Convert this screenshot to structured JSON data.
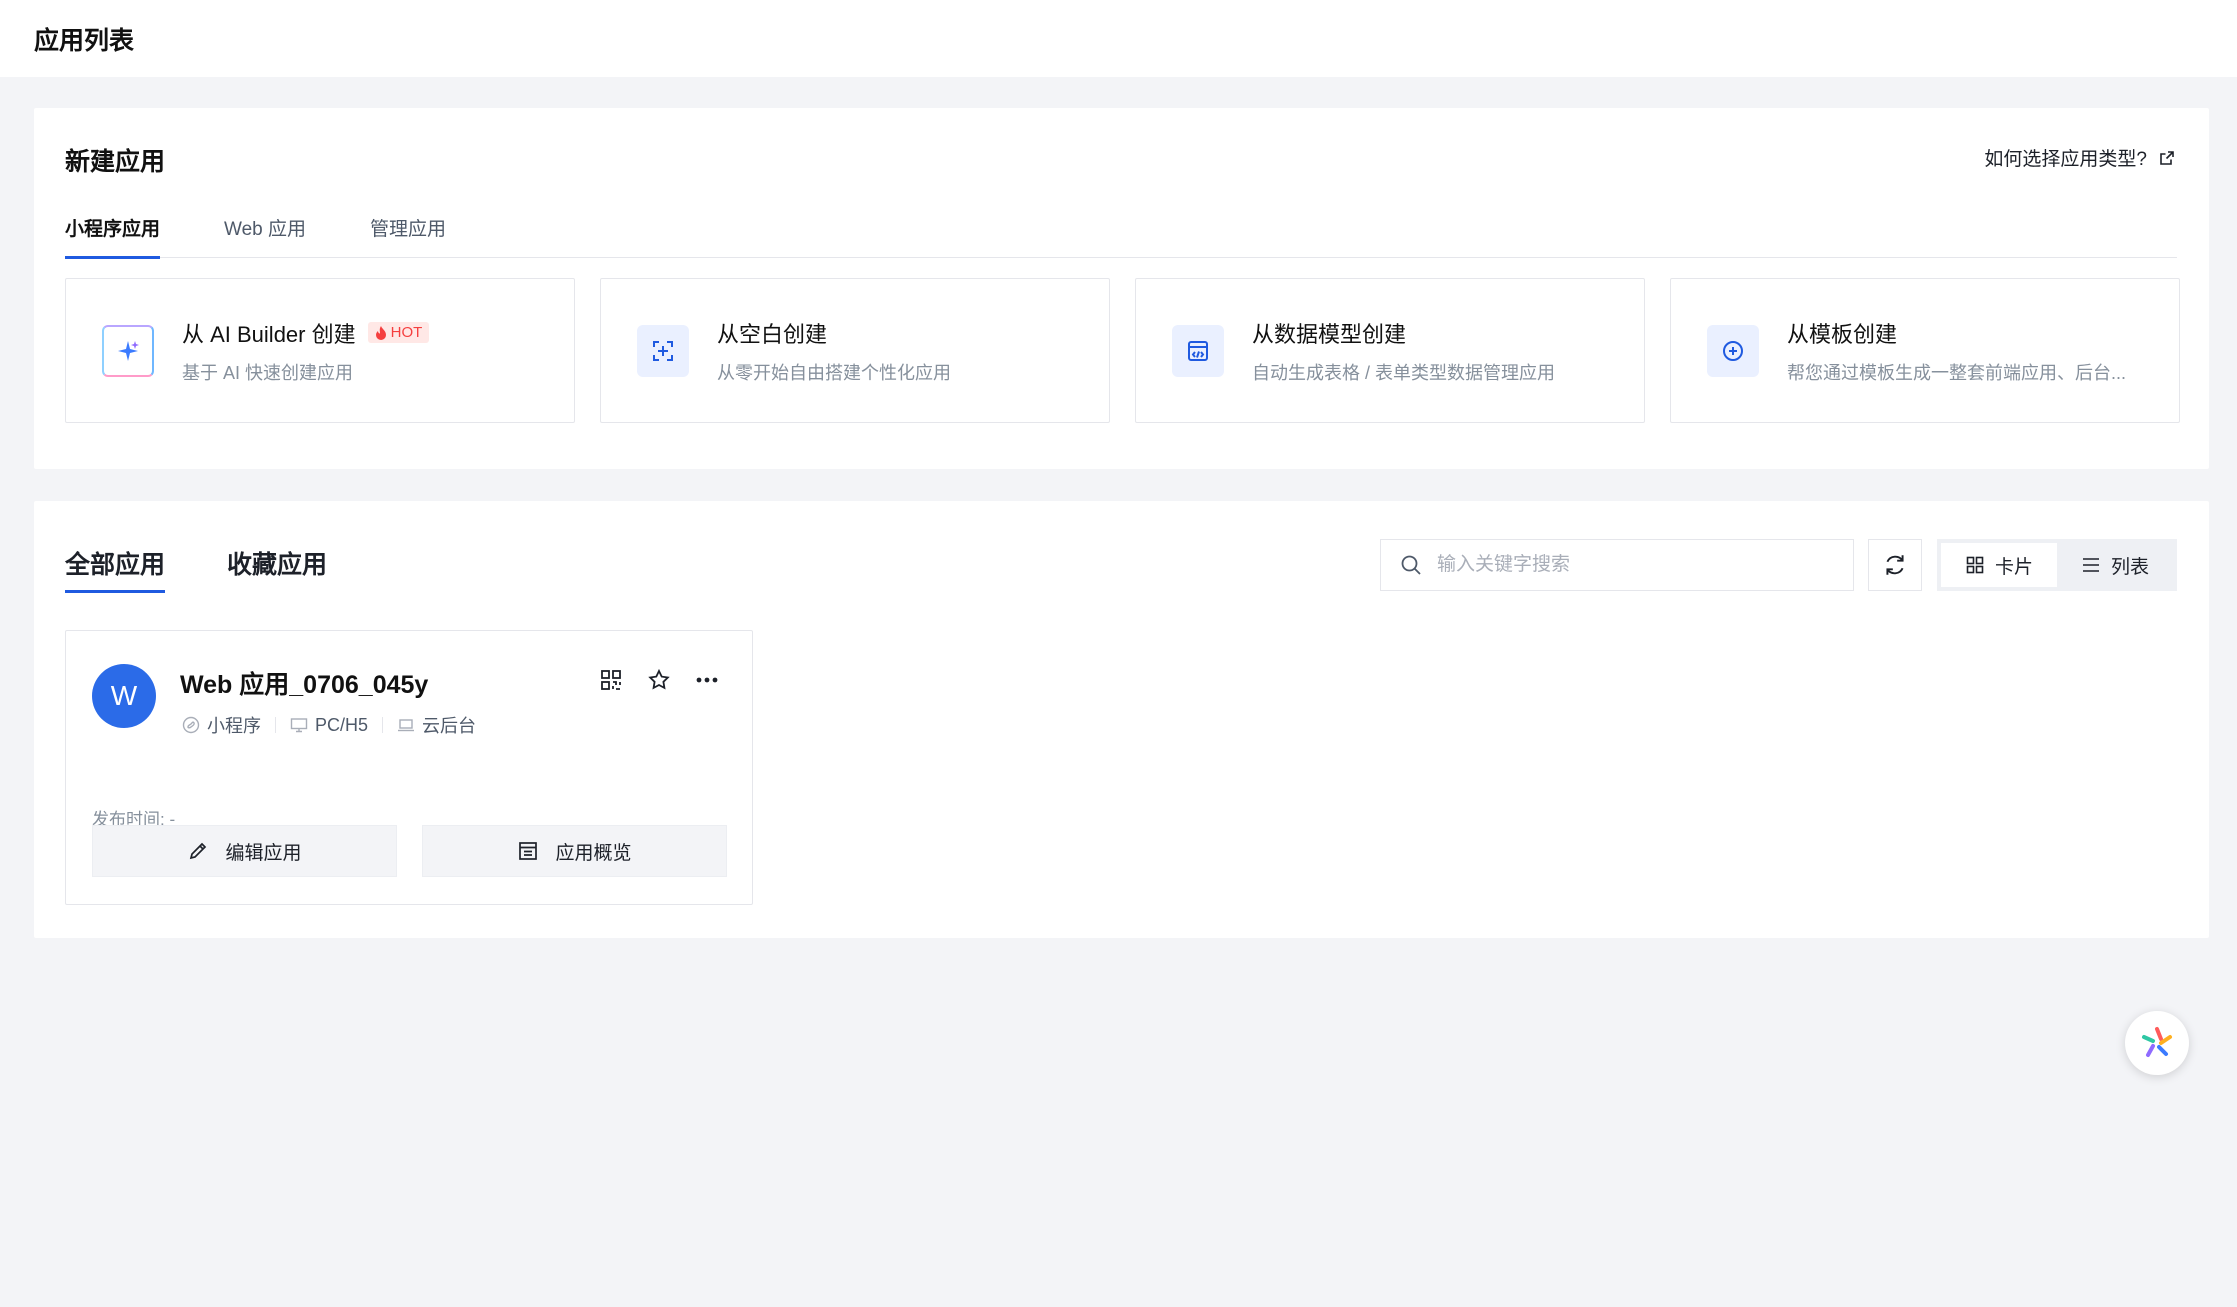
{
  "page": {
    "title": "应用列表"
  },
  "new_app": {
    "title": "新建应用",
    "help_link": "如何选择应用类型?",
    "tabs": [
      {
        "label": "小程序应用",
        "active": true
      },
      {
        "label": "Web 应用",
        "active": false
      },
      {
        "label": "管理应用",
        "active": false
      }
    ],
    "create_options": [
      {
        "title": "从 AI Builder 创建",
        "badge": "HOT",
        "desc": "基于 AI 快速创建应用",
        "icon": "sparkle-icon"
      },
      {
        "title": "从空白创建",
        "desc": "从零开始自由搭建个性化应用",
        "icon": "blank-add-icon"
      },
      {
        "title": "从数据模型创建",
        "desc": "自动生成表格 / 表单类型数据管理应用",
        "icon": "data-model-icon"
      },
      {
        "title": "从模板创建",
        "desc": "帮您通过模板生成一整套前端应用、后台...",
        "icon": "template-add-icon"
      }
    ]
  },
  "apps": {
    "tabs": [
      {
        "label": "全部应用",
        "active": true
      },
      {
        "label": "收藏应用",
        "active": false
      }
    ],
    "search": {
      "placeholder": "输入关键字搜索",
      "value": ""
    },
    "view_toggle": {
      "card": "卡片",
      "list": "列表",
      "selected": "card"
    },
    "items": [
      {
        "avatar": "W",
        "name": "Web 应用_0706_045y",
        "platforms": [
          "小程序",
          "PC/H5",
          "云后台"
        ],
        "publish_time": "发布时间: -",
        "edit_label": "编辑应用",
        "overview_label": "应用概览"
      }
    ]
  },
  "colors": {
    "accent": "#1f5ae0",
    "avatar": "#2b6be8",
    "hot": "#f53f3f"
  }
}
